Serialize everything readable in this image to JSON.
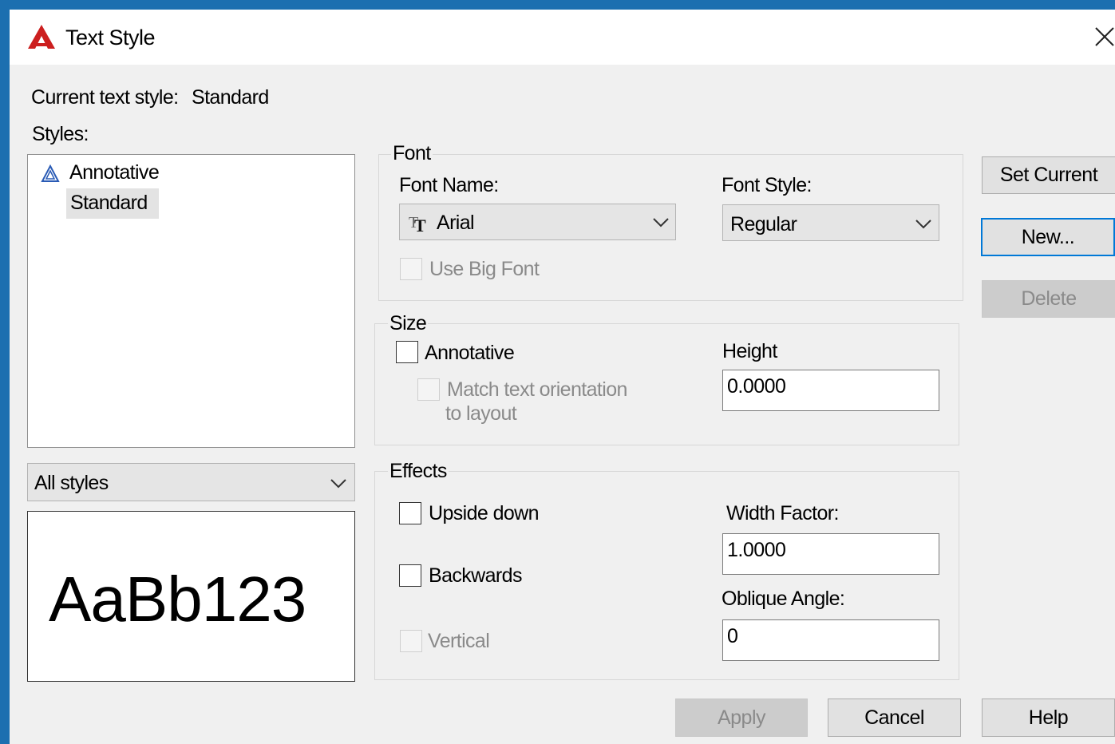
{
  "window": {
    "title": "Text Style",
    "icon": "autocad-logo-icon",
    "accent": "#cc1f1f"
  },
  "current_style": {
    "label": "Current text style:",
    "value": "Standard"
  },
  "styles": {
    "label": "Styles:",
    "items": [
      {
        "label": "Annotative",
        "icon": "annotative-icon",
        "selected": false
      },
      {
        "label": "Standard",
        "selected": true
      }
    ],
    "filter_value": "All styles"
  },
  "preview": {
    "text": "AaBb123"
  },
  "font": {
    "legend": "Font",
    "name_label": "Font Name:",
    "name_value": "Arial",
    "name_icon": "truetype-font-icon",
    "style_label": "Font Style:",
    "style_value": "Regular",
    "big_font_label": "Use Big Font",
    "big_font_checked": false
  },
  "size": {
    "legend": "Size",
    "annotative_label": "Annotative",
    "annotative_checked": false,
    "match_label_line1": "Match text orientation",
    "match_label_line2": "to layout",
    "height_label": "Height",
    "height_value": "0.0000"
  },
  "effects": {
    "legend": "Effects",
    "upside_down_label": "Upside down",
    "backwards_label": "Backwards",
    "vertical_label": "Vertical",
    "width_factor_label": "Width Factor:",
    "width_factor_value": "1.0000",
    "oblique_label": "Oblique Angle:",
    "oblique_value": "0"
  },
  "buttons": {
    "set_current": "Set Current",
    "new": "New...",
    "delete": "Delete",
    "apply": "Apply",
    "cancel": "Cancel",
    "help": "Help"
  }
}
